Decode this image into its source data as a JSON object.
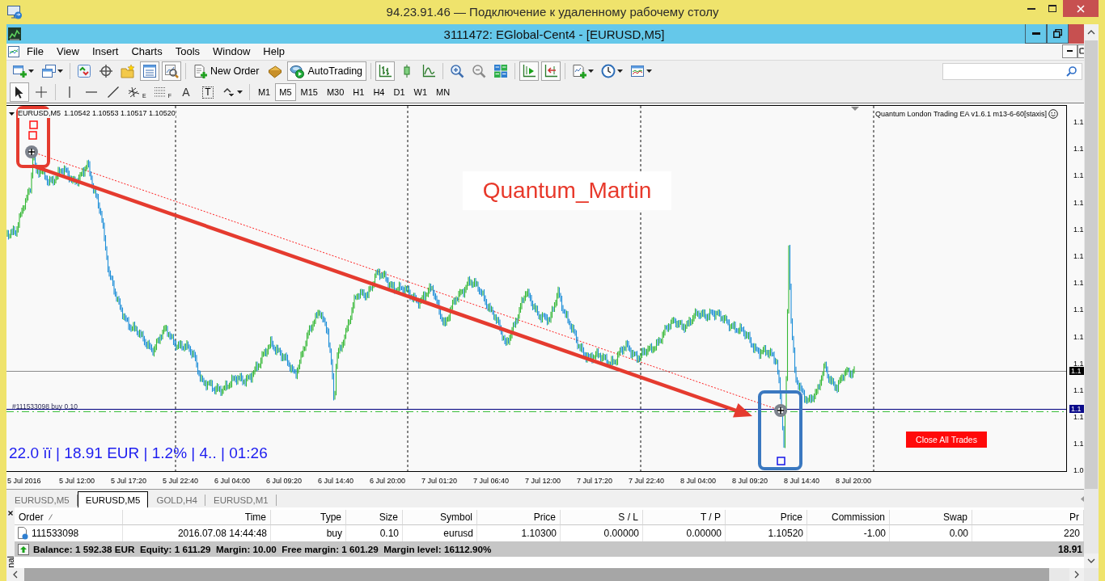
{
  "remote_window": {
    "title": "94.23.91.46 — Подключение к удаленному рабочему столу"
  },
  "app_window": {
    "title": "3111472: EGlobal-Cent4 - [EURUSD,M5]"
  },
  "menu": [
    "File",
    "View",
    "Insert",
    "Charts",
    "Tools",
    "Window",
    "Help"
  ],
  "toolbar": {
    "groups": [
      [
        {
          "kind": "new-chart",
          "dropdown": true,
          "pressed": false
        },
        {
          "kind": "profiles",
          "dropdown": true,
          "pressed": false
        }
      ],
      [
        {
          "kind": "market-watch",
          "pressed": false
        },
        {
          "kind": "navigator",
          "pressed": false
        },
        {
          "kind": "favorites",
          "pressed": false
        },
        {
          "kind": "terminal",
          "pressed": true
        },
        {
          "kind": "tester",
          "pressed": true
        }
      ],
      [
        {
          "kind": "new-order",
          "label": "New Order",
          "pressed": false
        },
        {
          "kind": "editor",
          "pressed": false
        },
        {
          "kind": "autotrading",
          "label": "AutoTrading",
          "pressed": true
        }
      ],
      [
        {
          "kind": "bar-chart",
          "pressed": true
        },
        {
          "kind": "candles",
          "pressed": false
        },
        {
          "kind": "line-chart",
          "pressed": false
        }
      ],
      [
        {
          "kind": "zoom-in",
          "pressed": false
        },
        {
          "kind": "zoom-out",
          "pressed": false
        },
        {
          "kind": "tile",
          "pressed": false
        }
      ],
      [
        {
          "kind": "autoscroll",
          "pressed": true
        },
        {
          "kind": "chart-shift",
          "pressed": true
        }
      ],
      [
        {
          "kind": "indicators",
          "dropdown": true,
          "pressed": false
        },
        {
          "kind": "periods",
          "dropdown": true,
          "pressed": false
        },
        {
          "kind": "templates",
          "dropdown": true,
          "pressed": false
        }
      ]
    ]
  },
  "drawing_toolbar": {
    "groups": [
      [
        {
          "kind": "cursor",
          "selected": true
        },
        {
          "kind": "crosshair",
          "selected": false
        }
      ],
      [
        {
          "kind": "vline",
          "selected": false
        },
        {
          "kind": "hline",
          "selected": false
        },
        {
          "kind": "trendline",
          "selected": false
        },
        {
          "kind": "channel",
          "glyph": "E",
          "selected": false
        },
        {
          "kind": "fibo",
          "glyph": "F",
          "selected": false
        },
        {
          "kind": "text",
          "glyph": "A",
          "selected": false
        },
        {
          "kind": "label",
          "glyph": "T",
          "selected": false
        },
        {
          "kind": "arrows",
          "dropdown": true,
          "selected": false
        }
      ]
    ]
  },
  "timeframes": [
    {
      "label": "M1",
      "selected": false
    },
    {
      "label": "M5",
      "selected": true
    },
    {
      "label": "M15",
      "selected": false
    },
    {
      "label": "M30",
      "selected": false
    },
    {
      "label": "H1",
      "selected": false
    },
    {
      "label": "H4",
      "selected": false
    },
    {
      "label": "D1",
      "selected": false
    },
    {
      "label": "W1",
      "selected": false
    },
    {
      "label": "MN",
      "selected": false
    }
  ],
  "chart": {
    "header": {
      "symbol": "EURUSD,M5",
      "prices": "1.10542 1.10553 1.10517 1.10520"
    },
    "expert": "Quantum London Trading EA v1.6.1 m13-6-60[staxis]",
    "annotation": "Quantum_Martin",
    "order_label": "#111533098 buy 0.10",
    "info": "22.0 ïï | 18.91 EUR | 1.2% | 4.. | 01:26",
    "close_button": "Close All Trades",
    "price_labels": [
      "1.1",
      "1.1",
      "1.1",
      "1.1",
      "1.1",
      "1.1",
      "1.1",
      "1.1",
      "1.1",
      "1.1",
      "1.1",
      "1.1",
      "1.1",
      "1.0"
    ],
    "bid_tag": "1.1",
    "order_tag": "1.1",
    "time_labels": [
      "5 Jul 2016",
      "5 Jul 12:00",
      "5 Jul 17:20",
      "5 Jul 22:40",
      "6 Jul 04:00",
      "6 Jul 09:20",
      "6 Jul 14:40",
      "6 Jul 20:00",
      "7 Jul 01:20",
      "7 Jul 06:40",
      "7 Jul 12:00",
      "7 Jul 17:20",
      "7 Jul 22:40",
      "8 Jul 04:00",
      "8 Jul 09:20",
      "8 Jul 14:40",
      "8 Jul 20:00"
    ]
  },
  "chart_tabs": [
    {
      "label": "EURUSD,M5",
      "selected": false
    },
    {
      "label": "EURUSD,M5",
      "selected": true
    },
    {
      "label": "GOLD,H4",
      "selected": false
    },
    {
      "label": "EURUSD,M1",
      "selected": false
    }
  ],
  "terminal": {
    "title": "nal",
    "columns": [
      {
        "label": "Order",
        "sorted": true
      },
      {
        "label": "Time",
        "sorted": false
      },
      {
        "label": "Type",
        "sorted": false
      },
      {
        "label": "Size",
        "sorted": false
      },
      {
        "label": "Symbol",
        "sorted": false
      },
      {
        "label": "Price",
        "sorted": false
      },
      {
        "label": "S / L",
        "sorted": false
      },
      {
        "label": "T / P",
        "sorted": false
      },
      {
        "label": "Price",
        "sorted": false
      },
      {
        "label": "Commission",
        "sorted": false
      },
      {
        "label": "Swap",
        "sorted": false
      },
      {
        "label": "Pr",
        "sorted": false
      }
    ],
    "rows": [
      {
        "cells": [
          "111533098",
          "2016.07.08 14:44:48",
          "buy",
          "0.10",
          "eurusd",
          "1.10300",
          "0.00000",
          "0.00000",
          "1.10520",
          "-1.00",
          "0.00",
          "220"
        ]
      }
    ],
    "summary": {
      "text": "Balance: 1 592.38 EUR  Equity: 1 611.29  Margin: 10.00  Free margin: 1 601.29  Margin level: 16112.90%",
      "profit": "18.91"
    }
  }
}
